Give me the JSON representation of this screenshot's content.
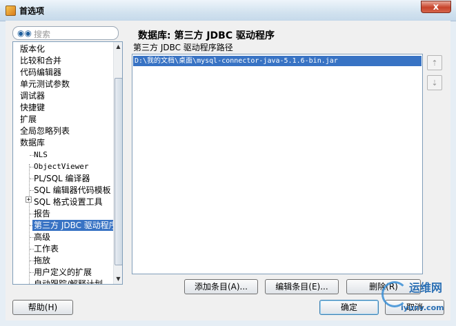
{
  "window": {
    "title": "首选项",
    "close_glyph": "x"
  },
  "search": {
    "icon": "binoculars-icon",
    "placeholder": "搜索"
  },
  "tree": {
    "items": [
      {
        "label": "版本化",
        "level": 0
      },
      {
        "label": "比较和合并",
        "level": 0
      },
      {
        "label": "代码编辑器",
        "level": 0
      },
      {
        "label": "单元测试参数",
        "level": 0
      },
      {
        "label": "调试器",
        "level": 0
      },
      {
        "label": "快捷键",
        "level": 0
      },
      {
        "label": "扩展",
        "level": 0
      },
      {
        "label": "全局忽略列表",
        "level": 0
      },
      {
        "label": "数据库",
        "level": 0
      },
      {
        "label": "NLS",
        "level": 1
      },
      {
        "label": "ObjectViewer",
        "level": 1
      },
      {
        "label": "PL/SQL 编译器",
        "level": 1
      },
      {
        "label": "SQL 编辑器代码模板",
        "level": 1
      },
      {
        "label": "SQL 格式设置工具",
        "level": 1,
        "expander": "+"
      },
      {
        "label": "报告",
        "level": 1
      },
      {
        "label": "第三方 JDBC 驱动程序",
        "level": 1,
        "selected": true
      },
      {
        "label": "高级",
        "level": 1
      },
      {
        "label": "工作表",
        "level": 1
      },
      {
        "label": "拖放",
        "level": 1
      },
      {
        "label": "用户定义的扩展",
        "level": 1
      },
      {
        "label": "自动跟踪/解释计划",
        "level": 1
      }
    ]
  },
  "main": {
    "title": "数据库: 第三方 JDBC 驱动程序",
    "list_label": "第三方 JDBC 驱动程序路径",
    "entries": [
      "D:\\我的文档\\桌面\\mysql-connector-java-5.1.6-bin.jar"
    ],
    "move_up_glyph": "⇡",
    "move_down_glyph": "⇣"
  },
  "buttons": {
    "add": "添加条目(A)...",
    "edit": "编辑条目(E)...",
    "delete": "删除(R)",
    "help": "帮助(H)",
    "ok": "确定",
    "cancel": "取消"
  },
  "watermark": {
    "cn": "运维网",
    "en": "iyunv.com"
  },
  "colors": {
    "selection": "#3873c4",
    "close_button": "#c7432b"
  }
}
